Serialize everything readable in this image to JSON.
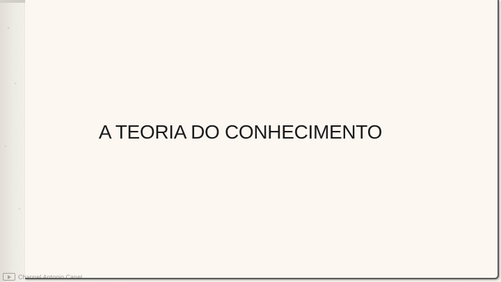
{
  "slide": {
    "title": "A TEORIA DO CONHECIMENTO"
  },
  "watermark": {
    "icon": "video-icon",
    "text": "Channel Antonio Canel"
  }
}
